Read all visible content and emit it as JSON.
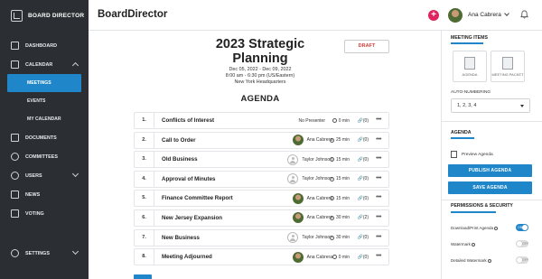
{
  "sidebar": {
    "brand": "BOARD DIRECTOR",
    "items": [
      {
        "label": "DASHBOARD",
        "icon": "dashboard-icon"
      },
      {
        "label": "CALENDAR",
        "icon": "calendar-icon",
        "expanded": true
      },
      {
        "label": "MEETINGS",
        "sub": true,
        "active": true
      },
      {
        "label": "EVENTS",
        "sub": true
      },
      {
        "label": "MY CALENDAR",
        "sub": true
      },
      {
        "label": "DOCUMENTS",
        "icon": "documents-icon"
      },
      {
        "label": "COMMITTEES",
        "icon": "committees-icon"
      },
      {
        "label": "USERS",
        "icon": "users-icon"
      },
      {
        "label": "NEWS",
        "icon": "news-icon"
      },
      {
        "label": "VOTING",
        "icon": "voting-icon"
      },
      {
        "label": "SETTINGS",
        "icon": "settings-icon"
      }
    ]
  },
  "topbar": {
    "title": "BoardDirector",
    "user_name": "Ana Cabrera",
    "plus_label": "+"
  },
  "meeting": {
    "draft_label": "DRAFT",
    "title": "2023 Strategic Planning",
    "dates": "Dec 05, 2022 - Dec 09, 2022",
    "time": "8:00 am - 6:30 pm (US/Eastern)",
    "location": "New York Headquarters",
    "agenda_heading": "AGENDA"
  },
  "agenda_items": [
    {
      "num": "1.",
      "title": "Conflicts of Interest",
      "presenter": "No Presenter",
      "avatar": "none",
      "duration": "0 min",
      "attachments": "(0)"
    },
    {
      "num": "2.",
      "title": "Call to Order",
      "presenter": "Ana Cabrera",
      "avatar": "photo",
      "duration": "25 min",
      "attachments": "(0)"
    },
    {
      "num": "3.",
      "title": "Old Business",
      "presenter": "Taylor Johnson",
      "avatar": "placeholder",
      "duration": "15 min",
      "attachments": "(0)"
    },
    {
      "num": "4.",
      "title": "Approval of Minutes",
      "presenter": "Taylor Johnson",
      "avatar": "placeholder",
      "duration": "15 min",
      "attachments": "(0)"
    },
    {
      "num": "5.",
      "title": "Finance Committee Report",
      "presenter": "Ana Cabrera",
      "avatar": "photo",
      "duration": "15 min",
      "attachments": "(0)"
    },
    {
      "num": "6.",
      "title": "New Jersey Expansion",
      "presenter": "Ana Cabrera",
      "avatar": "photo",
      "duration": "30 min",
      "attachments": "(2)"
    },
    {
      "num": "7.",
      "title": "New Business",
      "presenter": "Taylor Johnson",
      "avatar": "placeholder",
      "duration": "30 min",
      "attachments": "(0)"
    },
    {
      "num": "8.",
      "title": "Meeting Adjourned",
      "presenter": "Ana Cabrera",
      "avatar": "photo",
      "duration": "0 min",
      "attachments": "(0)"
    }
  ],
  "right_panel": {
    "meeting_items_title": "MEETING ITEMS",
    "tile_agenda": "AGENDA",
    "tile_packet": "MEETING PACKET",
    "auto_numbering_label": "AUTO-NUMBERING",
    "auto_numbering_value": "1, 2, 3, 4",
    "agenda_title": "AGENDA",
    "preview_label": "Preview Agenda",
    "publish_label": "PUBLISH AGENDA",
    "save_label": "SAVE AGENDA",
    "permissions_title": "PERMISSIONS & SECURITY",
    "perm_download": "Download/Print Agenda",
    "perm_watermark": "Watermark",
    "perm_detailed_watermark": "Detailed Watermark",
    "toggle_on": "ON",
    "toggle_off": "OFF"
  },
  "colors": {
    "accent": "#1f86c9",
    "sidebar_bg": "#2b2f33",
    "draft": "#d63c3c",
    "plus": "#e0245e"
  }
}
